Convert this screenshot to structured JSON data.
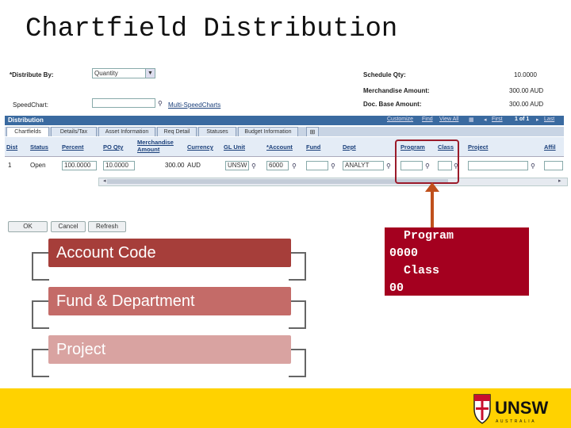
{
  "slide": {
    "title": "Chartfield Distribution",
    "callout_lines": [
      "  Program",
      "0000",
      "  Class",
      "00"
    ],
    "list_items": [
      "Account Code",
      "Fund & Department",
      "Project"
    ],
    "colors": {
      "callout_bg": "#a4001f",
      "item1": "#a63e3a",
      "item2": "#c46b68",
      "item3": "#d9a3a1",
      "footer": "#ffd200",
      "arrow": "#c0501c"
    }
  },
  "form": {
    "distribute_by_label": "*Distribute By:",
    "distribute_by_value": "Quantity",
    "speedchart_label": "SpeedChart:",
    "multi_speedcharts_link": "Multi-SpeedCharts",
    "schedule_qty_label": "Schedule Qty:",
    "schedule_qty_value": "10.0000",
    "merch_amount_label": "Merchandise Amount:",
    "merch_amount_value": "300.00 AUD",
    "doc_base_label": "Doc. Base Amount:",
    "doc_base_value": "300.00 AUD"
  },
  "grid": {
    "title": "Distribution",
    "nav": {
      "customize": "Customize",
      "find": "Find",
      "view_all": "View All",
      "first": "First",
      "range": "1 of 1",
      "last": "Last"
    },
    "tabs": [
      "Chartfields",
      "Details/Tax",
      "Asset Information",
      "Req Detail",
      "Statuses",
      "Budget Information"
    ],
    "columns": [
      "Dist",
      "Status",
      "Percent",
      "PO Qty",
      "Merchandise Amount",
      "Currency",
      "GL Unit",
      "*Account",
      "Fund",
      "Dept",
      "Program",
      "Class",
      "Project",
      "Affil"
    ],
    "row": {
      "dist": "1",
      "status": "Open",
      "percent": "100.0000",
      "po_qty": "10.0000",
      "merch_amount": "300.00",
      "currency": "AUD",
      "gl_unit": "UNSW",
      "account": "6000",
      "fund": "",
      "dept": "ANALYT",
      "program": "",
      "class": "",
      "project": "",
      "affil": ""
    }
  },
  "buttons": {
    "ok": "OK",
    "cancel": "Cancel",
    "refresh": "Refresh"
  },
  "brand": {
    "logo_text": "UNSW",
    "logo_sub": "AUSTRALIA"
  }
}
